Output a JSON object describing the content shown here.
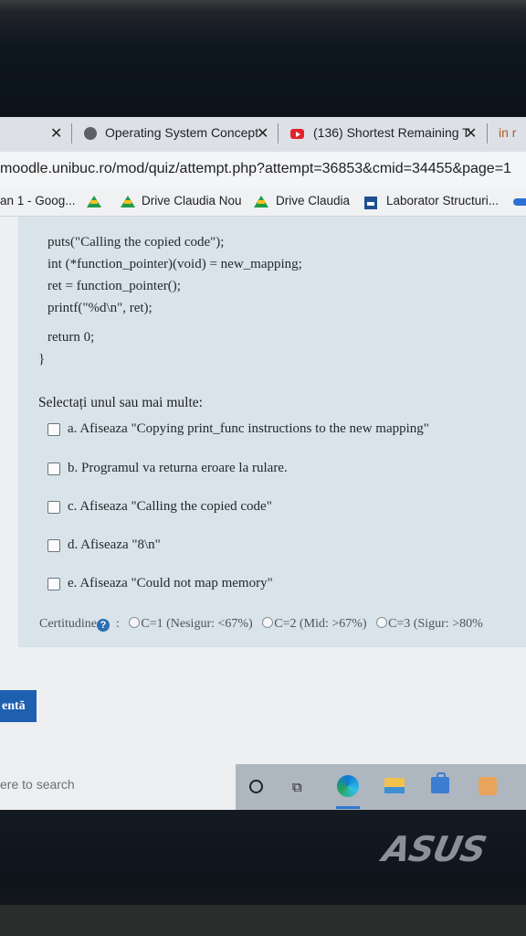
{
  "browser": {
    "tabs": [
      {
        "title": "Operating System Concept"
      },
      {
        "title": "(136) Shortest Remaining T"
      }
    ],
    "tab_extra": "in r",
    "url": "moodle.unibuc.ro/mod/quiz/attempt.php?attempt=36853&cmid=34455&page=1",
    "bookmarks": [
      "an 1 - Goog...",
      "Drive Claudia Nou",
      "Drive Claudia",
      "Laborator Structuri..."
    ]
  },
  "code_lines": [
    "puts(\"Calling the copied code\");",
    "int (*function_pointer)(void) = new_mapping;",
    "ret = function_pointer();",
    "printf(\"%d\\n\", ret);",
    "return 0;",
    "}"
  ],
  "question": {
    "prompt": "Selectați unul sau mai multe:",
    "options": [
      "a. Afiseaza \"Copying print_func instructions to the new mapping\"",
      "b. Programul va returna eroare la rulare.",
      "c. Afiseaza \"Calling the copied code\"",
      "d. Afiseaza \"8\\n\"",
      "e. Afiseaza \"Could not map memory\""
    ],
    "certainty_label": "Certitudine",
    "certainty_options": [
      "C=1 (Nesigur: <67%)",
      "C=2 (Mid: >67%)",
      "C=3 (Sigur: >80%"
    ]
  },
  "nav_button": "entă",
  "taskbar": {
    "search_placeholder": "ere to search"
  },
  "laptop_logo": "ASUS"
}
